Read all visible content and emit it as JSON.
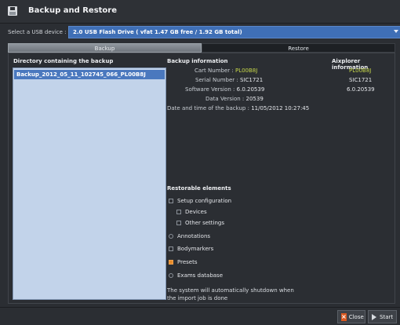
{
  "window": {
    "title": "Backup and Restore",
    "icon": "floppy-disk-icon"
  },
  "usb": {
    "label": "Select a USB device :",
    "selected": "2.0 USB Flash Drive ( vfat 1.47 GB free / 1.92 GB total)"
  },
  "tabs": [
    {
      "label": "Backup"
    },
    {
      "label": "Restore"
    }
  ],
  "directory": {
    "header": "Directory containing the backup",
    "items": [
      "Backup_2012_05_11_102745_066_PL00B8J"
    ]
  },
  "backup_info": {
    "header": "Backup information",
    "rows": [
      {
        "label": "Cart Number :",
        "value": "PL00B8J"
      },
      {
        "label": "Serial Number :",
        "value": "SIC1721"
      },
      {
        "label": "Software Version :",
        "value": "6.0.20539"
      },
      {
        "label": "Data Version :",
        "value": "20539"
      },
      {
        "label": "Date and time of the backup :",
        "value": "11/05/2012 10:27:45"
      }
    ]
  },
  "aixplorer_info": {
    "header": "Aixplorer information",
    "values": [
      "PL00B8J",
      "SIC1721",
      "6.0.20539"
    ]
  },
  "restorable": {
    "header": "Restorable elements",
    "setup": "Setup configuration",
    "devices": "Devices",
    "other": "Other settings",
    "annotations": "Annotations",
    "bodymarkers": "Bodymarkers",
    "presets": "Presets",
    "exams": "Exams database"
  },
  "note": "The system will automatically shutdown when the import job is done",
  "buttons": {
    "close": "Close",
    "start": "Start"
  },
  "colors": {
    "accent": "#4a78be",
    "highlight": "#c7d84a",
    "checked": "#e78b2a"
  }
}
